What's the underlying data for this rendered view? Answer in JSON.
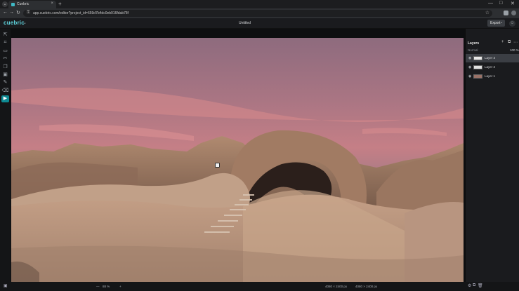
{
  "browser": {
    "tab_title": "Cuebric",
    "tab_close": "×",
    "new_tab": "+",
    "menu": "⌄",
    "url": "app.cuebric.com/editor?project_id=659d7b4dc0eb916fdab78f",
    "lock_icon": "⚿",
    "bookmark_icon": "☆",
    "window_controls": [
      "—",
      "□",
      "✕"
    ],
    "nav": [
      "←",
      "→",
      "↻",
      "⌂"
    ]
  },
  "app": {
    "logo": "cuebric",
    "logo_caret": "⌄",
    "document_title": "Untitled",
    "export_label": "Export",
    "export_caret": "⌄",
    "avatar_icon": "☺",
    "accent": "#0e8a93"
  },
  "toolbar": {
    "tools": [
      {
        "name": "select-tool",
        "glyph": "⇱"
      },
      {
        "name": "crop-tool",
        "glyph": "⌗"
      },
      {
        "name": "image-tool",
        "glyph": "▭"
      },
      {
        "name": "transform-tool",
        "glyph": "✂"
      },
      {
        "name": "layers-tool",
        "glyph": "❐"
      },
      {
        "name": "generate-tool",
        "glyph": "▣"
      },
      {
        "name": "brush-tool",
        "glyph": "✎"
      },
      {
        "name": "eraser-tool",
        "glyph": "⌫"
      },
      {
        "name": "segment-tool",
        "glyph": "▶"
      }
    ],
    "active_index": 8
  },
  "layers_panel": {
    "title": "Layers",
    "blend_mode": "Normal",
    "opacity": "100 %",
    "actions": [
      "+",
      "⧉",
      "⋯"
    ],
    "layers": [
      {
        "name": "Layer 3",
        "visible_icon": "◉",
        "selected": true,
        "thumb_color": "#e8e8e8"
      },
      {
        "name": "Layer 2",
        "visible_icon": "◉",
        "selected": false,
        "thumb_color": "#e0e0e0"
      },
      {
        "name": "Layer 1",
        "visible_icon": "◉",
        "selected": false,
        "thumb_color": "#9a7268"
      }
    ],
    "bottom_actions": [
      "⚙",
      "⧉",
      "🗑"
    ]
  },
  "statusbar": {
    "zoom_minus": "—",
    "zoom": "88 %",
    "zoom_plus": "+",
    "image_size": "4080 × 2400 px",
    "canvas_size": "4080 × 2400 px",
    "left_icon": "▣"
  }
}
